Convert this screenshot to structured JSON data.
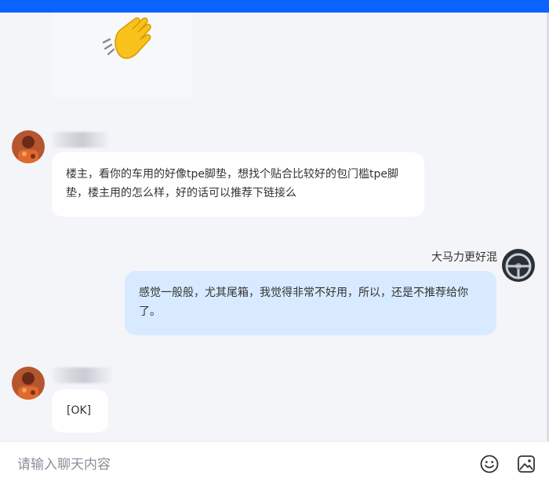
{
  "icons": {
    "sticker": "waving-hand-icon",
    "emoji": "emoji-smile-icon",
    "image": "image-upload-icon"
  },
  "colors": {
    "topbar": "#0a63ff",
    "incoming_bubble": "#ffffff",
    "outgoing_bubble": "#d8eaff",
    "background": "#f4f5f9"
  },
  "messages": [
    {
      "sender": "",
      "text": "楼主，看你的车用的好像tpe脚垫，想找个贴合比较好的包门槛tpe脚垫，楼主用的怎么样，好的话可以推荐下链接么"
    },
    {
      "sender": "大马力更好混",
      "text": "感觉一般般，尤其尾箱，我觉得非常不好用，所以，还是不推荐给你了。"
    },
    {
      "sender": "",
      "text": "[OK]"
    }
  ],
  "composer": {
    "placeholder": "请输入聊天内容"
  }
}
